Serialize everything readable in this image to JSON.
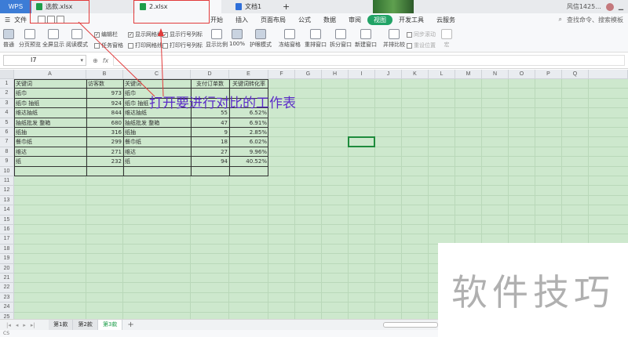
{
  "titlebar": {
    "app_name": "WPS",
    "tabs": [
      {
        "label": "选款.xlsx",
        "active": false
      },
      {
        "label": "2.xlsx",
        "active": true
      },
      {
        "label": "文档1",
        "active": false
      }
    ],
    "add_tab": "+",
    "user_name": "风信1425..."
  },
  "menubar": {
    "file_label": "文件",
    "tabs": [
      "开始",
      "插入",
      "页面布局",
      "公式",
      "数据",
      "审阅",
      "视图",
      "开发工具",
      "云服务"
    ],
    "active_tab": "视图",
    "search_label": "查找命令、搜索模板"
  },
  "ribbon": {
    "normal": "普通",
    "page_break": "分页预览",
    "fullscreen": "全屏显示",
    "reading_mode": "阅读模式",
    "edit_bar": "编辑栏",
    "show_grid": "显示网格线",
    "show_rowcol": "显示行号列标",
    "task_pane": "任务窗格",
    "print_grid": "打印网格线",
    "print_rowcol": "打印行号列标",
    "show_scale": "显示比例",
    "zoom_100": "100%",
    "eye_mode": "护眼模式",
    "freeze": "冻结窗格",
    "rearrange": "重排窗口",
    "split": "拆分窗口",
    "new_window": "新建窗口",
    "side_by_side": "并排比较",
    "sync_scroll": "同步滚动",
    "reset_position": "重设位置",
    "macro": "宏"
  },
  "formulabar": {
    "namebox": "I7",
    "fx": "fx"
  },
  "sheet": {
    "columns": [
      "A",
      "B",
      "C",
      "D",
      "E",
      "F",
      "G",
      "H",
      "I",
      "J",
      "K",
      "L",
      "M",
      "N",
      "O",
      "P",
      "Q"
    ],
    "rows": [
      "1",
      "2",
      "3",
      "4",
      "5",
      "6",
      "7",
      "8",
      "9",
      "10",
      "11",
      "12",
      "13",
      "14",
      "15",
      "16",
      "17",
      "18",
      "19",
      "20",
      "21",
      "22",
      "23",
      "24",
      "25"
    ],
    "headers": [
      "关键词",
      "访客数",
      "关键词",
      "支付订单数",
      "关键词转化率"
    ],
    "data": [
      [
        "纸巾",
        "973",
        "纸巾",
        "",
        ""
      ],
      [
        "纸巾 抽纸",
        "924",
        "纸巾 抽纸",
        "",
        ""
      ],
      [
        "维达抽纸",
        "844",
        "维达抽纸",
        "55",
        "6.52%"
      ],
      [
        "抽纸批发 整箱",
        "680",
        "抽纸批发 整箱",
        "47",
        "6.91%"
      ],
      [
        "纸抽",
        "316",
        "纸抽",
        "9",
        "2.85%"
      ],
      [
        "餐巾纸",
        "299",
        "餐巾纸",
        "18",
        "6.02%"
      ],
      [
        "维达",
        "271",
        "维达",
        "27",
        "9.96%"
      ],
      [
        "纸",
        "232",
        "纸",
        "94",
        "40.52%"
      ]
    ]
  },
  "annotation": "打开要进行对比的工作表",
  "sheet_tabs": [
    "第1款",
    "第2款",
    "第3款"
  ],
  "active_sheet": "第3款",
  "add_sheet": "+",
  "status": "CS",
  "watermark": "软件技巧"
}
